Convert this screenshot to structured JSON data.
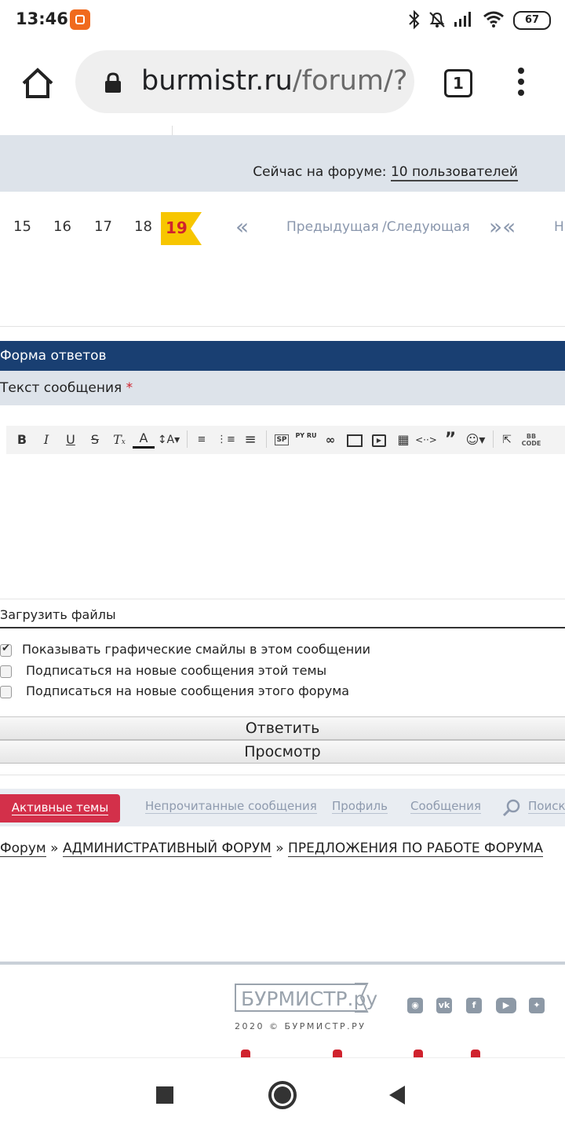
{
  "status_bar": {
    "time": "13:46",
    "battery": "67"
  },
  "browser": {
    "url_host": "burmistr.ru",
    "url_path": "/forum/?",
    "tab_count": "1"
  },
  "forum": {
    "online_label": "Сейчас на форуме:",
    "online_link": "10 пользователей",
    "pagination": {
      "pages": [
        "15",
        "16",
        "17",
        "18"
      ],
      "current": "19",
      "prev_label": "Предыдущая",
      "next_label": "/Следующая",
      "first_symbol": "«",
      "nav_symbol": "»«",
      "trailing": "Н"
    },
    "reply_form": {
      "header": "Форма ответов",
      "message_label": "Текст сообщения",
      "required_mark": "*",
      "upload_label": "Загрузить файлы",
      "options": [
        {
          "label": "Показывать графические смайлы в этом сообщении",
          "checked": true
        },
        {
          "label": "Подписаться на новые сообщения этой темы",
          "checked": false
        },
        {
          "label": "Подписаться на новые сообщения этого форума",
          "checked": false
        }
      ],
      "reply_button": "Ответить",
      "preview_button": "Просмотр"
    },
    "toolbar_icons": [
      "bold-icon",
      "italic-icon",
      "underline-icon",
      "strikethrough-icon",
      "clear-format-icon",
      "font-color-icon",
      "font-size-icon",
      "ordered-list-icon",
      "unordered-list-icon",
      "align-icon",
      "spoiler-icon",
      "translit-icon",
      "link-icon",
      "image-icon",
      "video-icon",
      "table-icon",
      "code-icon",
      "quote-icon",
      "emoji-icon",
      "fullscreen-icon",
      "bbcode-icon"
    ],
    "toolbar_glyphs": {
      "spoiler": "SP",
      "translit": "PY RU",
      "bbcode": "BB CODE"
    },
    "nav": {
      "active": "Активные темы",
      "unread": "Непрочитанные сообщения",
      "profile": "Профиль",
      "messages": "Сообщения",
      "search": "Поиск"
    },
    "breadcrumbs": {
      "root": "Форум",
      "sep": "»",
      "section": "АДМИНИСТРАТИВНЫЙ ФОРУМ",
      "subsection": "ПРЕДЛОЖЕНИЯ ПО РАБОТЕ ФОРУМА"
    }
  },
  "footer": {
    "logo_text": "БУРМИСТР.ру",
    "copyright": "2020 © БУРМИСТР.РУ",
    "social_icons": [
      "instagram-icon",
      "vk-icon",
      "facebook-icon",
      "youtube-icon",
      "zen-icon"
    ]
  },
  "colors": {
    "accent_red": "#d3304a",
    "header_blue": "#193f72",
    "light_bar": "#dde3ea",
    "current_page_yellow": "#f7c600"
  }
}
